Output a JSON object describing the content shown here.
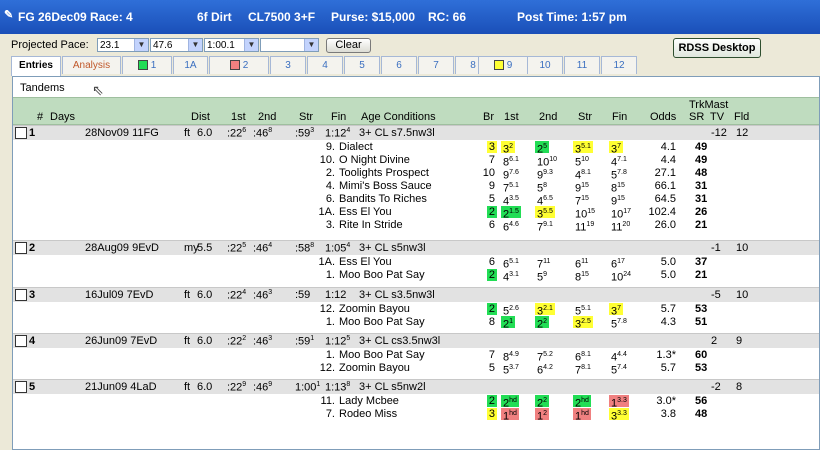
{
  "titlebar": {
    "race": "FG 26Dec09 Race: 4",
    "dist": "6f Dirt",
    "cls": "CL7500 3+F",
    "purse": "Purse: $15,000",
    "rc": "RC: 66",
    "post": "Post Time: 1:57 pm"
  },
  "toolbar": {
    "pace_label": "Projected Pace:",
    "sel1": "23.1",
    "sel2": "47.6",
    "sel3": "1:00.1",
    "sel4": "",
    "clear": "Clear",
    "rdss": "RDSS Desktop"
  },
  "tabs": [
    "Entries",
    "Analysis",
    "1",
    "1A",
    "2",
    "3",
    "4",
    "5",
    "6",
    "7",
    "8",
    "9",
    "10",
    "11",
    "12"
  ],
  "tab_square_colors": {
    "1": "#22dd55",
    "2": "#f08080",
    "9": "#ffff33"
  },
  "panel_title": "Tandems",
  "headers": {
    "num": "#",
    "days": "Days",
    "dist": "Dist",
    "c1": "1st",
    "c2": "2nd",
    "str": "Str",
    "fin": "Fin",
    "age": "Age Conditions",
    "br": "Br",
    "h1": "1st",
    "h2": "2nd",
    "hstr": "Str",
    "hfin": "Fin",
    "odds": "Odds",
    "trk": "TrkMast",
    "sr": "SR",
    "tv": "TV",
    "fld": "Fld"
  },
  "races": [
    {
      "num": "1",
      "date": "28Nov09 11FG",
      "surf": "ft",
      "dist": "6.0",
      "c1": ":22",
      "c1s": "6",
      "c2": ":46",
      "c2s": "8",
      "str": ":59",
      "strs": "3",
      "fin": "1:12",
      "fins": "4",
      "cond": "3+ CL s7.5nw3l",
      "tv": "-12",
      "fld": "12",
      "horses": [
        {
          "pp": "9.",
          "name": "Dialect",
          "br": "3",
          "brc": "yel",
          "f": "3",
          "fs": "2",
          "fc": "yel",
          "s": "2",
          "ss": "5",
          "sc": "grn",
          "st": "3",
          "sts": "5.1",
          "stc": "yel",
          "fi": "3",
          "fis": "7",
          "fic": "yel",
          "odds": "4.1",
          "sr": "49"
        },
        {
          "pp": "10.",
          "name": "O Night Divine",
          "br": "7",
          "brc": "",
          "f": "8",
          "fs": "6.1",
          "fc": "",
          "s": "10",
          "ss": "10",
          "sc": "",
          "st": "5",
          "sts": "10",
          "stc": "",
          "fi": "4",
          "fis": "7.1",
          "fic": "",
          "odds": "4.4",
          "sr": "49"
        },
        {
          "pp": "2.",
          "name": "Toolights Prospect",
          "br": "10",
          "brc": "",
          "f": "9",
          "fs": "7.6",
          "fc": "",
          "s": "9",
          "ss": "9.3",
          "sc": "",
          "st": "4",
          "sts": "8.1",
          "stc": "",
          "fi": "5",
          "fis": "7.8",
          "fic": "",
          "odds": "27.1",
          "sr": "48"
        },
        {
          "pp": "4.",
          "name": "Mimi's Boss Sauce",
          "br": "9",
          "brc": "",
          "f": "7",
          "fs": "5.1",
          "fc": "",
          "s": "5",
          "ss": "8",
          "sc": "",
          "st": "9",
          "sts": "15",
          "stc": "",
          "fi": "8",
          "fis": "15",
          "fic": "",
          "odds": "66.1",
          "sr": "31"
        },
        {
          "pp": "6.",
          "name": "Bandits To Riches",
          "br": "5",
          "brc": "",
          "f": "4",
          "fs": "3.5",
          "fc": "",
          "s": "4",
          "ss": "6.5",
          "sc": "",
          "st": "7",
          "sts": "15",
          "stc": "",
          "fi": "9",
          "fis": "15",
          "fic": "",
          "odds": "64.5",
          "sr": "31"
        },
        {
          "pp": "1A.",
          "name": "Ess El You",
          "br": "2",
          "brc": "grn",
          "f": "2",
          "fs": "1.5",
          "fc": "grn",
          "s": "3",
          "ss": "5.5",
          "sc": "yel",
          "st": "10",
          "sts": "15",
          "stc": "",
          "fi": "10",
          "fis": "17",
          "fic": "",
          "odds": "102.4",
          "sr": "26"
        },
        {
          "pp": "3.",
          "name": "Rite In Stride",
          "br": "6",
          "brc": "",
          "f": "6",
          "fs": "4.6",
          "fc": "",
          "s": "7",
          "ss": "9.1",
          "sc": "",
          "st": "11",
          "sts": "19",
          "stc": "",
          "fi": "11",
          "fis": "20",
          "fic": "",
          "odds": "26.0",
          "sr": "21"
        }
      ]
    },
    {
      "num": "2",
      "date": "28Aug09 9EvD",
      "surf": "my",
      "dist": "5.5",
      "c1": ":22",
      "c1s": "5",
      "c2": ":46",
      "c2s": "4",
      "str": ":58",
      "strs": "8",
      "fin": "1:05",
      "fins": "4",
      "cond": "3+ CL s5nw3l",
      "tv": "-1",
      "fld": "10",
      "horses": [
        {
          "pp": "1A.",
          "name": "Ess El You",
          "br": "6",
          "brc": "",
          "f": "6",
          "fs": "5.1",
          "fc": "",
          "s": "7",
          "ss": "11",
          "sc": "",
          "st": "6",
          "sts": "11",
          "stc": "",
          "fi": "6",
          "fis": "17",
          "fic": "",
          "odds": "5.0",
          "sr": "37"
        },
        {
          "pp": "1.",
          "name": "Moo Boo Pat Say",
          "br": "2",
          "brc": "grn",
          "f": "4",
          "fs": "3.1",
          "fc": "",
          "s": "5",
          "ss": "9",
          "sc": "",
          "st": "8",
          "sts": "15",
          "stc": "",
          "fi": "10",
          "fis": "24",
          "fic": "",
          "odds": "5.0",
          "sr": "21"
        }
      ]
    },
    {
      "num": "3",
      "date": "16Jul09 7EvD",
      "surf": "ft",
      "dist": "6.0",
      "c1": ":22",
      "c1s": "4",
      "c2": ":46",
      "c2s": "3",
      "str": ":59",
      "strs": "",
      "fin": "1:12",
      "fins": "",
      "cond": "3+ CL s3.5nw3l",
      "tv": "-5",
      "fld": "10",
      "horses": [
        {
          "pp": "12.",
          "name": "Zoomin Bayou",
          "br": "2",
          "brc": "grn",
          "f": "5",
          "fs": "2.6",
          "fc": "",
          "s": "3",
          "ss": "2.1",
          "sc": "yel",
          "st": "5",
          "sts": "5.1",
          "stc": "",
          "fi": "3",
          "fis": "7",
          "fic": "yel",
          "odds": "5.7",
          "sr": "53"
        },
        {
          "pp": "1.",
          "name": "Moo Boo Pat Say",
          "br": "8",
          "brc": "",
          "f": "2",
          "fs": "1",
          "fc": "grn",
          "s": "2",
          "ss": "2",
          "sc": "grn",
          "st": "3",
          "sts": "2.5",
          "stc": "yel",
          "fi": "5",
          "fis": "7.8",
          "fic": "",
          "odds": "4.3",
          "sr": "51"
        }
      ]
    },
    {
      "num": "4",
      "date": "26Jun09 7EvD",
      "surf": "ft",
      "dist": "6.0",
      "c1": ":22",
      "c1s": "2",
      "c2": ":46",
      "c2s": "3",
      "str": ":59",
      "strs": "1",
      "fin": "1:12",
      "fins": "5",
      "cond": "3+ CL cs3.5nw3l",
      "tv": "2",
      "fld": "9",
      "horses": [
        {
          "pp": "1.",
          "name": "Moo Boo Pat Say",
          "br": "7",
          "brc": "",
          "f": "8",
          "fs": "4.9",
          "fc": "",
          "s": "7",
          "ss": "5.2",
          "sc": "",
          "st": "6",
          "sts": "8.1",
          "stc": "",
          "fi": "4",
          "fis": "4.4",
          "fic": "",
          "odds": "1.3*",
          "sr": "60"
        },
        {
          "pp": "12.",
          "name": "Zoomin Bayou",
          "br": "5",
          "brc": "",
          "f": "5",
          "fs": "3.7",
          "fc": "",
          "s": "6",
          "ss": "4.2",
          "sc": "",
          "st": "7",
          "sts": "8.1",
          "stc": "",
          "fi": "5",
          "fis": "7.4",
          "fic": "",
          "odds": "5.7",
          "sr": "53"
        }
      ]
    },
    {
      "num": "5",
      "date": "21Jun09 4LaD",
      "surf": "ft",
      "dist": "6.0",
      "c1": ":22",
      "c1s": "9",
      "c2": ":46",
      "c2s": "9",
      "str": "1:00",
      "strs": "1",
      "fin": "1:13",
      "fins": "8",
      "cond": "3+ CL s5nw2l",
      "tv": "-2",
      "fld": "8",
      "horses": [
        {
          "pp": "11.",
          "name": "Lady Mcbee",
          "br": "2",
          "brc": "grn",
          "f": "2",
          "fs": "hd",
          "fc": "grn",
          "s": "2",
          "ss": "2",
          "sc": "grn",
          "st": "2",
          "sts": "hd",
          "stc": "grn",
          "fi": "1",
          "fis": "3.3",
          "fic": "red",
          "odds": "3.0*",
          "sr": "56"
        },
        {
          "pp": "7.",
          "name": "Rodeo Miss",
          "br": "3",
          "brc": "yel",
          "f": "1",
          "fs": "hd",
          "fc": "red",
          "s": "1",
          "ss": "2",
          "sc": "red",
          "st": "1",
          "sts": "hd",
          "stc": "red",
          "fi": "3",
          "fis": "3.3",
          "fic": "yel",
          "odds": "3.8",
          "sr": "48"
        }
      ]
    }
  ]
}
